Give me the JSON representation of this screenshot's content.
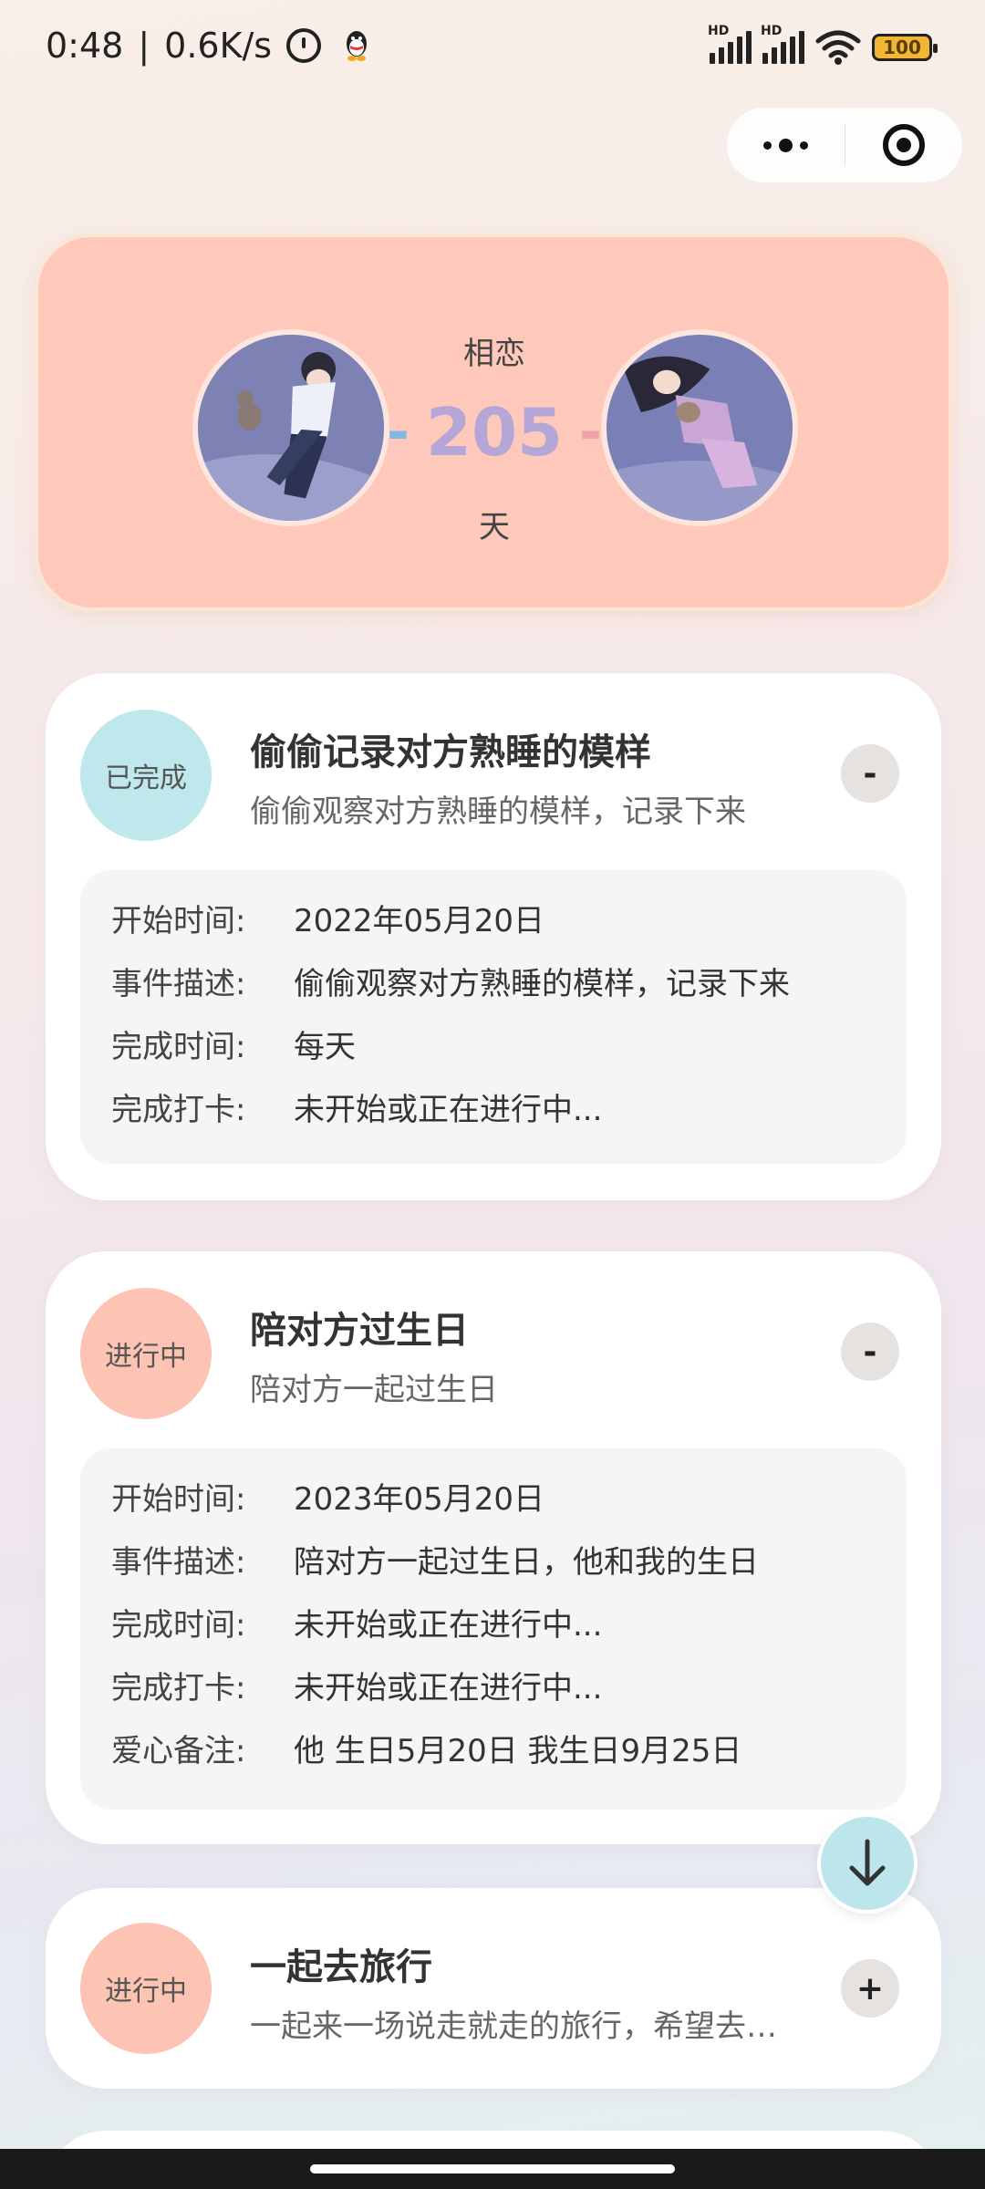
{
  "status_bar": {
    "time": "0:48",
    "network_speed": "0.6K/s",
    "battery": "100",
    "signal_label": "HD",
    "icons": [
      "alarm-icon",
      "qq-icon",
      "signal-icon",
      "wifi-icon",
      "battery-icon"
    ]
  },
  "capsule": {
    "icons": [
      "more-dots-icon",
      "target-icon"
    ]
  },
  "hero": {
    "top_label": "相恋",
    "days": "205",
    "dash": "-",
    "bottom_label": "天"
  },
  "cards": [
    {
      "status": "已完成",
      "title": "偷偷记录对方熟睡的模样",
      "subtitle": "偷偷观察对方熟睡的模样，记录下来",
      "toggle": "-",
      "details": [
        {
          "key": "开始时间:",
          "value": "2022年05月20日"
        },
        {
          "key": "事件描述:",
          "value": "偷偷观察对方熟睡的模样，记录下来"
        },
        {
          "key": "完成时间:",
          "value": "每天"
        },
        {
          "key": "完成打卡:",
          "value": "未开始或正在进行中..."
        }
      ]
    },
    {
      "status": "进行中",
      "title": "陪对方过生日",
      "subtitle": "陪对方一起过生日",
      "toggle": "-",
      "details": [
        {
          "key": "开始时间:",
          "value": "2023年05月20日"
        },
        {
          "key": "事件描述:",
          "value": "陪对方一起过生日，他和我的生日"
        },
        {
          "key": "完成时间:",
          "value": "未开始或正在进行中..."
        },
        {
          "key": "完成打卡:",
          "value": "未开始或正在进行中..."
        },
        {
          "key": "爱心备注:",
          "value": "他 生日5月20日 我生日9月25日"
        }
      ]
    },
    {
      "status": "进行中",
      "title": "一起去旅行",
      "subtitle": "一起来一场说走就走的旅行，希望去…",
      "toggle": "+"
    }
  ],
  "colors": {
    "hero_bg": "#fec9bb",
    "done_badge": "#bfe8ec",
    "doing_badge": "#fdc3b3",
    "days_number": "#b4a6d6"
  }
}
